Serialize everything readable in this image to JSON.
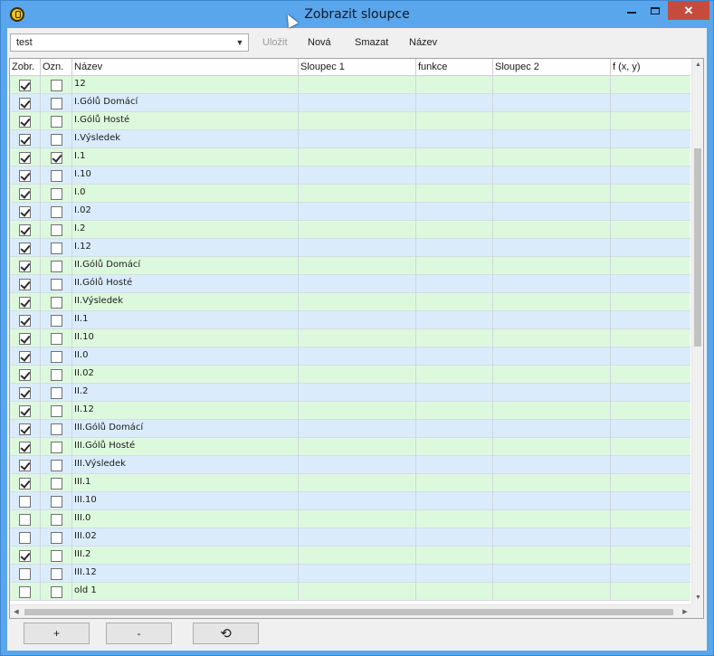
{
  "window": {
    "title": "Zobrazit sloupce",
    "minimize_glyph": "",
    "maximize_glyph": "",
    "close_glyph": "✕"
  },
  "toolbar": {
    "selected_view": "test",
    "buttons": {
      "save": "Uložit",
      "new": "Nová",
      "delete": "Smazat",
      "rename": "Název"
    },
    "save_enabled": false
  },
  "grid": {
    "columns": [
      "Zobr.",
      "Ozn.",
      "Název",
      "Sloupec 1",
      "funkce",
      "Sloupec 2",
      "f (x, y)"
    ],
    "rows": [
      {
        "show": true,
        "mark": false,
        "name": "12"
      },
      {
        "show": true,
        "mark": false,
        "name": "I.Gólů Domácí"
      },
      {
        "show": true,
        "mark": false,
        "name": "I.Gólů Hosté"
      },
      {
        "show": true,
        "mark": false,
        "name": "I.Výsledek"
      },
      {
        "show": true,
        "mark": true,
        "name": "I.1"
      },
      {
        "show": true,
        "mark": false,
        "name": "I.10"
      },
      {
        "show": true,
        "mark": false,
        "name": "I.0"
      },
      {
        "show": true,
        "mark": false,
        "name": "I.02"
      },
      {
        "show": true,
        "mark": false,
        "name": "I.2"
      },
      {
        "show": true,
        "mark": false,
        "name": "I.12"
      },
      {
        "show": true,
        "mark": false,
        "name": "II.Gólů Domácí"
      },
      {
        "show": true,
        "mark": false,
        "name": "II.Gólů Hosté"
      },
      {
        "show": true,
        "mark": false,
        "name": "II.Výsledek"
      },
      {
        "show": true,
        "mark": false,
        "name": "II.1"
      },
      {
        "show": true,
        "mark": false,
        "name": "II.10"
      },
      {
        "show": true,
        "mark": false,
        "name": "II.0"
      },
      {
        "show": true,
        "mark": false,
        "name": "II.02"
      },
      {
        "show": true,
        "mark": false,
        "name": "II.2"
      },
      {
        "show": true,
        "mark": false,
        "name": "II.12"
      },
      {
        "show": true,
        "mark": false,
        "name": "III.Gólů Domácí"
      },
      {
        "show": true,
        "mark": false,
        "name": "III.Gólů Hosté"
      },
      {
        "show": true,
        "mark": false,
        "name": "III.Výsledek"
      },
      {
        "show": true,
        "mark": false,
        "name": "III.1"
      },
      {
        "show": false,
        "mark": false,
        "name": "III.10"
      },
      {
        "show": false,
        "mark": false,
        "name": "III.0"
      },
      {
        "show": false,
        "mark": false,
        "name": "III.02"
      },
      {
        "show": true,
        "mark": false,
        "name": "III.2"
      },
      {
        "show": false,
        "mark": false,
        "name": "III.12"
      },
      {
        "show": false,
        "mark": false,
        "name": "old 1"
      }
    ]
  },
  "footer": {
    "add_label": "+",
    "remove_label": "-",
    "refresh_icon": "⟲"
  },
  "colors": {
    "title_bar": "#5aa6ec",
    "close_button": "#c74b3c",
    "row_green": "#ddf9dd",
    "row_blue": "#daecfc"
  }
}
